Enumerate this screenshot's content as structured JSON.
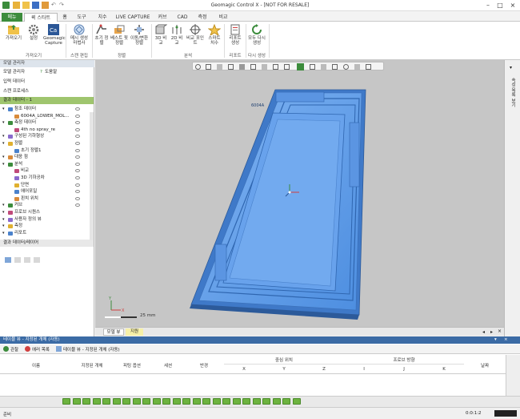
{
  "title": "Geomagic Control X - [NOT FOR RESALE]",
  "tabs": [
    "메뉴",
    "퀵 스타트",
    "홈",
    "도구",
    "치수",
    "LIVE CAPTURE",
    "커브",
    "CAD",
    "측정",
    "비교"
  ],
  "ribbon": {
    "import_label": "가져오기",
    "settings_label": "설정",
    "capture_label": "Geomagic Capture",
    "mesh_label": "메시 생성 마법사",
    "initial_align_label": "초기 정렬",
    "best_fit_label": "베스트 핏 정렬",
    "transform_label": "이동/변환 정렬",
    "compare3d_label": "3D 비교",
    "compare2d_label": "2D 비교",
    "point_compare_label": "비교 포인트",
    "smart_dim_label": "스마트 치수",
    "report_label": "리포트 생성",
    "regen_label": "모두 다시 생성",
    "groups": [
      "가져오기",
      "스캔 편집",
      "정렬",
      "분석",
      "리포트",
      "다시 생성"
    ]
  },
  "left": {
    "header": "모델 관리자",
    "subtabs": [
      "모델 관리자",
      "도움말"
    ],
    "sec_input": "입력 데이터",
    "sec_scan": "스캔 프로세스",
    "sec_result": "결과 데이터 - 1",
    "tree": [
      {
        "label": "참조 데이터",
        "level": 1
      },
      {
        "label": "6004A_LOWER_MOL...",
        "level": 2
      },
      {
        "label": "측정 데이터",
        "level": 1
      },
      {
        "label": "4th no spray_re",
        "level": 2
      },
      {
        "label": "구성된 기하형상",
        "level": 1
      },
      {
        "label": "정렬",
        "level": 1
      },
      {
        "label": "초기 정렬1",
        "level": 2
      },
      {
        "label": "대응 점",
        "level": 1
      },
      {
        "label": "분석",
        "level": 1
      },
      {
        "label": "비교",
        "level": 2
      },
      {
        "label": "3D 기하공차",
        "level": 2
      },
      {
        "label": "단면",
        "level": 2
      },
      {
        "label": "에어포일",
        "level": 2
      },
      {
        "label": "핀치 위치",
        "level": 2
      },
      {
        "label": "커브",
        "level": 1
      },
      {
        "label": "프로브 시퀀스",
        "level": 1
      },
      {
        "label": "사용자 정의 뷰",
        "level": 1
      },
      {
        "label": "측정",
        "level": 1
      },
      {
        "label": "리포트",
        "level": 1
      }
    ],
    "sec_compare": "결과 데이터/레이어"
  },
  "viewport": {
    "tabs": [
      "모델 뷰",
      "지원"
    ],
    "scale": "25 mm",
    "part_text": "6004A"
  },
  "right_strip": {
    "label": "속성 목록 보기"
  },
  "bottom": {
    "header": "테이블 뷰 - 지정된 개체 (자동)",
    "tools": [
      "관찰",
      "에러 목록",
      "테이블 뷰 - 지정된 개체 (자동)"
    ],
    "columns": [
      "이름",
      "지정된 개체",
      "피팅 옵션",
      "세션",
      "반경",
      "중심 위치",
      "프로브 방향",
      "날짜"
    ],
    "sub_center": [
      "X",
      "Y",
      "Z"
    ],
    "sub_probe": [
      "I",
      "J",
      "K"
    ]
  },
  "status": {
    "left": "준비",
    "right": "0:0:1:2"
  },
  "colors": {
    "accent": "#3b6ba5",
    "file_tab": "#3c8c3c",
    "model": "#5d9be8"
  }
}
